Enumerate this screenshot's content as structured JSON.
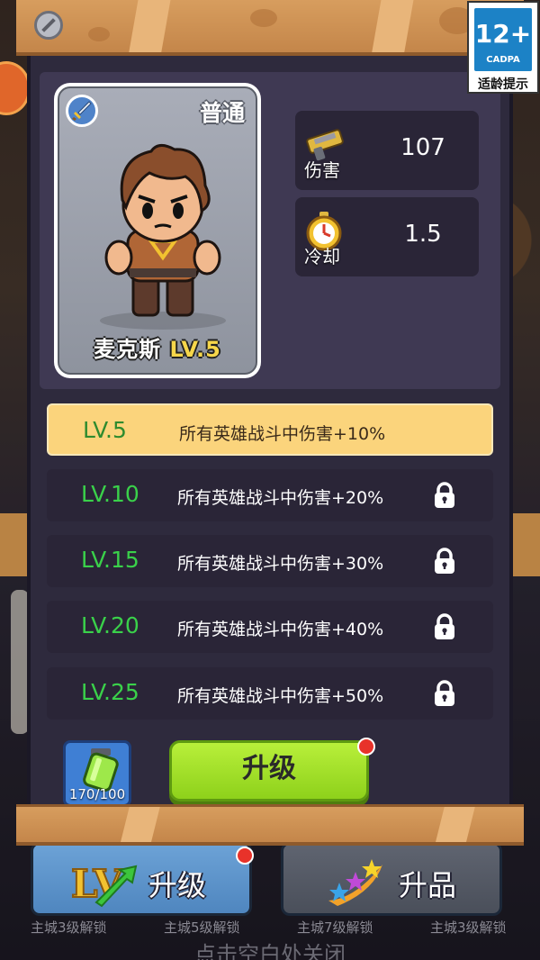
{
  "hero": {
    "rarity": "普通",
    "name": "麦克斯",
    "level": "LV.5",
    "weapon_icon": "sword-icon"
  },
  "stats": {
    "damage": {
      "label": "伤害",
      "value": "107",
      "icon": "gun-icon"
    },
    "cooldown": {
      "label": "冷却",
      "value": "1.5",
      "icon": "stopwatch-icon"
    }
  },
  "level_bonuses": [
    {
      "level": "LV.5",
      "bonus": "所有英雄战斗中伤害+10%",
      "unlocked": true
    },
    {
      "level": "LV.10",
      "bonus": "所有英雄战斗中伤害+20%",
      "unlocked": false
    },
    {
      "level": "LV.15",
      "bonus": "所有英雄战斗中伤害+30%",
      "unlocked": false
    },
    {
      "level": "LV.20",
      "bonus": "所有英雄战斗中伤害+40%",
      "unlocked": false
    },
    {
      "level": "LV.25",
      "bonus": "所有英雄战斗中伤害+50%",
      "unlocked": false
    }
  ],
  "upgrade": {
    "potion_count": "170/100",
    "button_label": "升级",
    "has_notification": true
  },
  "bottom_tabs": {
    "upgrade_label": "升级",
    "promote_label": "升品",
    "unlock_labels": [
      "主城3级解锁",
      "主城5级解锁",
      "主城7级解锁",
      "主城3级解锁"
    ]
  },
  "close_hint": "点击空白处关闭",
  "age_rating": {
    "age": "12+",
    "org": "CADPA",
    "tip": "适龄提示"
  },
  "colors": {
    "active_row": "#fbd47c",
    "level_green": "#3ad14a",
    "upgrade_green": "#9ad924",
    "panel": "#2e2a3d"
  }
}
